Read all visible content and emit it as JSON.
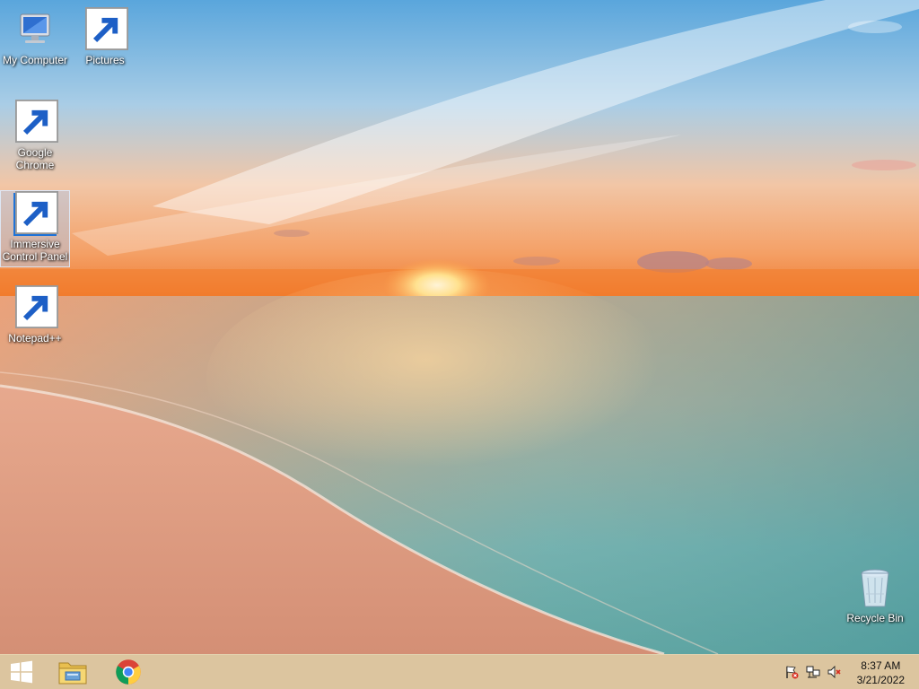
{
  "desktop": {
    "icons": [
      {
        "label": "My Computer",
        "icon": "my-computer-icon"
      },
      {
        "label": "Pictures",
        "icon": "pictures-folder-icon"
      },
      {
        "label": "Google\nChrome",
        "icon": "chrome-icon"
      },
      {
        "label": "Immersive\nControl Panel",
        "icon": "gear-icon",
        "selected": true
      },
      {
        "label": "Notepad++",
        "icon": "notepad-plus-plus-icon"
      },
      {
        "label": "Recycle Bin",
        "icon": "recycle-bin-icon"
      }
    ]
  },
  "taskbar": {
    "start_icon": "windows-logo-icon",
    "pinned": [
      {
        "name": "File Explorer",
        "icon": "file-explorer-icon"
      },
      {
        "name": "Google Chrome",
        "icon": "chrome-icon"
      }
    ],
    "tray": [
      {
        "icon": "action-center-flag-icon"
      },
      {
        "icon": "network-icon"
      },
      {
        "icon": "volume-muted-icon"
      }
    ],
    "clock": {
      "time": "8:37 AM",
      "date": "3/21/2022"
    }
  },
  "colors": {
    "taskbar": "#d4b88a",
    "selection": "#aac8f0",
    "sky_top": "#5aa6dc",
    "sunset": "#f08a3c",
    "sea": "#6fb7b5",
    "sand": "#e6a488"
  }
}
